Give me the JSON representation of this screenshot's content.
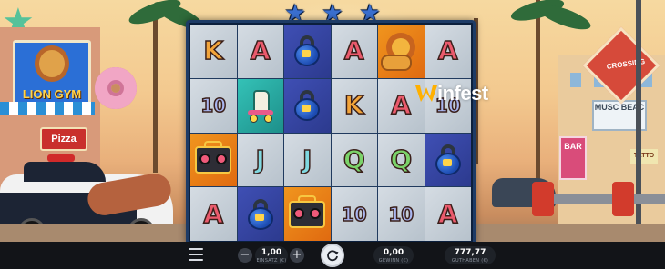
{
  "game": {
    "logo_text": "infest",
    "stars_count": 3
  },
  "scene": {
    "gym_sign": "LION GYM",
    "pizza_sign": "Pizza",
    "crossing_sign": "CROSSING",
    "bar_sign": "BAR",
    "muscle_sign": "MUSC BEAC",
    "tattoo_sign": "TATTO"
  },
  "reels": {
    "rows": [
      [
        "K",
        "A",
        "kettlebell",
        "A",
        "lion",
        "A"
      ],
      [
        "10",
        "skates",
        "kettlebell",
        "K",
        "A",
        "10"
      ],
      [
        "boombox",
        "J",
        "J",
        "Q",
        "Q",
        "kettlebell"
      ],
      [
        "A",
        "kettlebell",
        "boombox",
        "10",
        "10",
        "A"
      ]
    ]
  },
  "bottom_bar": {
    "bet_value": "1,00",
    "bet_label": "EINSATZ (€)",
    "win_value": "0,00",
    "win_label": "GEWINN (€)",
    "balance_value": "777,77",
    "balance_label": "GUTHABEN (€)",
    "minus_label": "−",
    "plus_label": "+"
  },
  "colors": {
    "frame": "#0b1f3c",
    "bar": "#121418",
    "star": "#3a6fcf"
  }
}
